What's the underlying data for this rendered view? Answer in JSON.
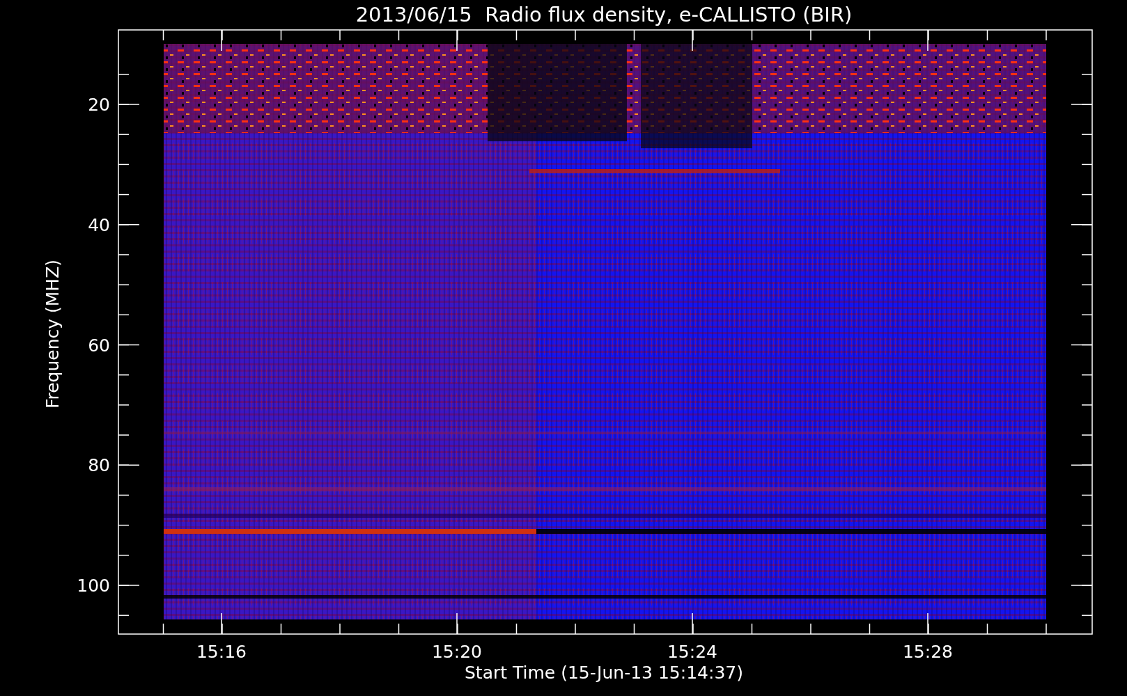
{
  "title": "2013/06/15  Radio flux density, e-CALLISTO (BIR)",
  "y_axis": {
    "label": "Frequency (MHZ)",
    "ticks": [
      "20",
      "40",
      "60",
      "80",
      "100"
    ]
  },
  "x_axis": {
    "label": "Start Time (15-Jun-13 15:14:37)",
    "ticks": [
      "15:16",
      "15:20",
      "15:24",
      "15:28"
    ]
  }
}
